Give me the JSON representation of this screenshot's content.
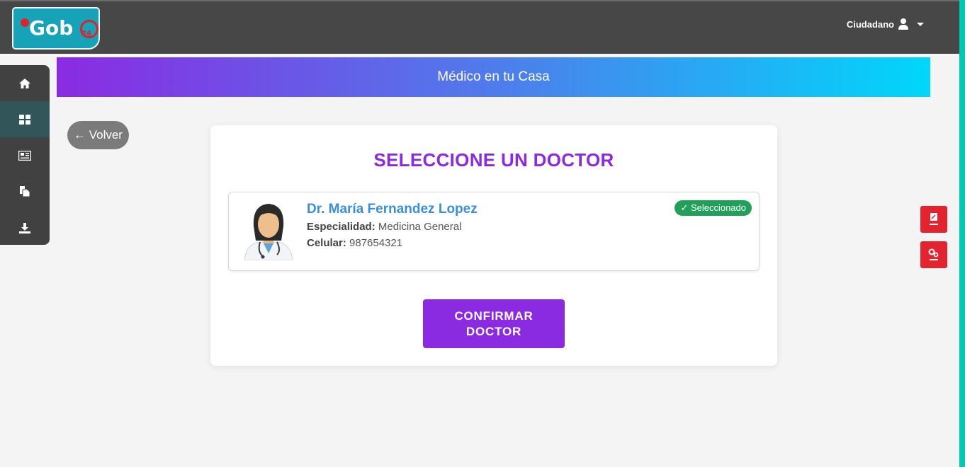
{
  "header": {
    "logo_text": "Gob",
    "logo_badge": "24",
    "user_label": "Ciudadano"
  },
  "sidebar": {
    "items": [
      {
        "icon": "home-icon"
      },
      {
        "icon": "dashboard-icon",
        "active": true
      },
      {
        "icon": "news-icon"
      },
      {
        "icon": "documents-icon"
      },
      {
        "icon": "download-icon"
      }
    ]
  },
  "banner": {
    "title": "Médico en tu Casa"
  },
  "back_button": {
    "label": "← Volver"
  },
  "main": {
    "title": "SELECCIONE UN DOCTOR",
    "doctor": {
      "name": "Dr. María Fernandez Lopez",
      "specialty_label": "Especialidad:",
      "specialty_value": "Medicina General",
      "phone_label": "Celular:",
      "phone_value": "987654321",
      "status_badge": "✓ Seleccionado"
    },
    "confirm_button": "CONFIRMAR DOCTOR"
  },
  "colors": {
    "accent": "#8a2be2",
    "topbar": "#474747",
    "success": "#21a05a",
    "float_buttons": "#e3232d",
    "doctor_name": "#3b8fd6"
  }
}
